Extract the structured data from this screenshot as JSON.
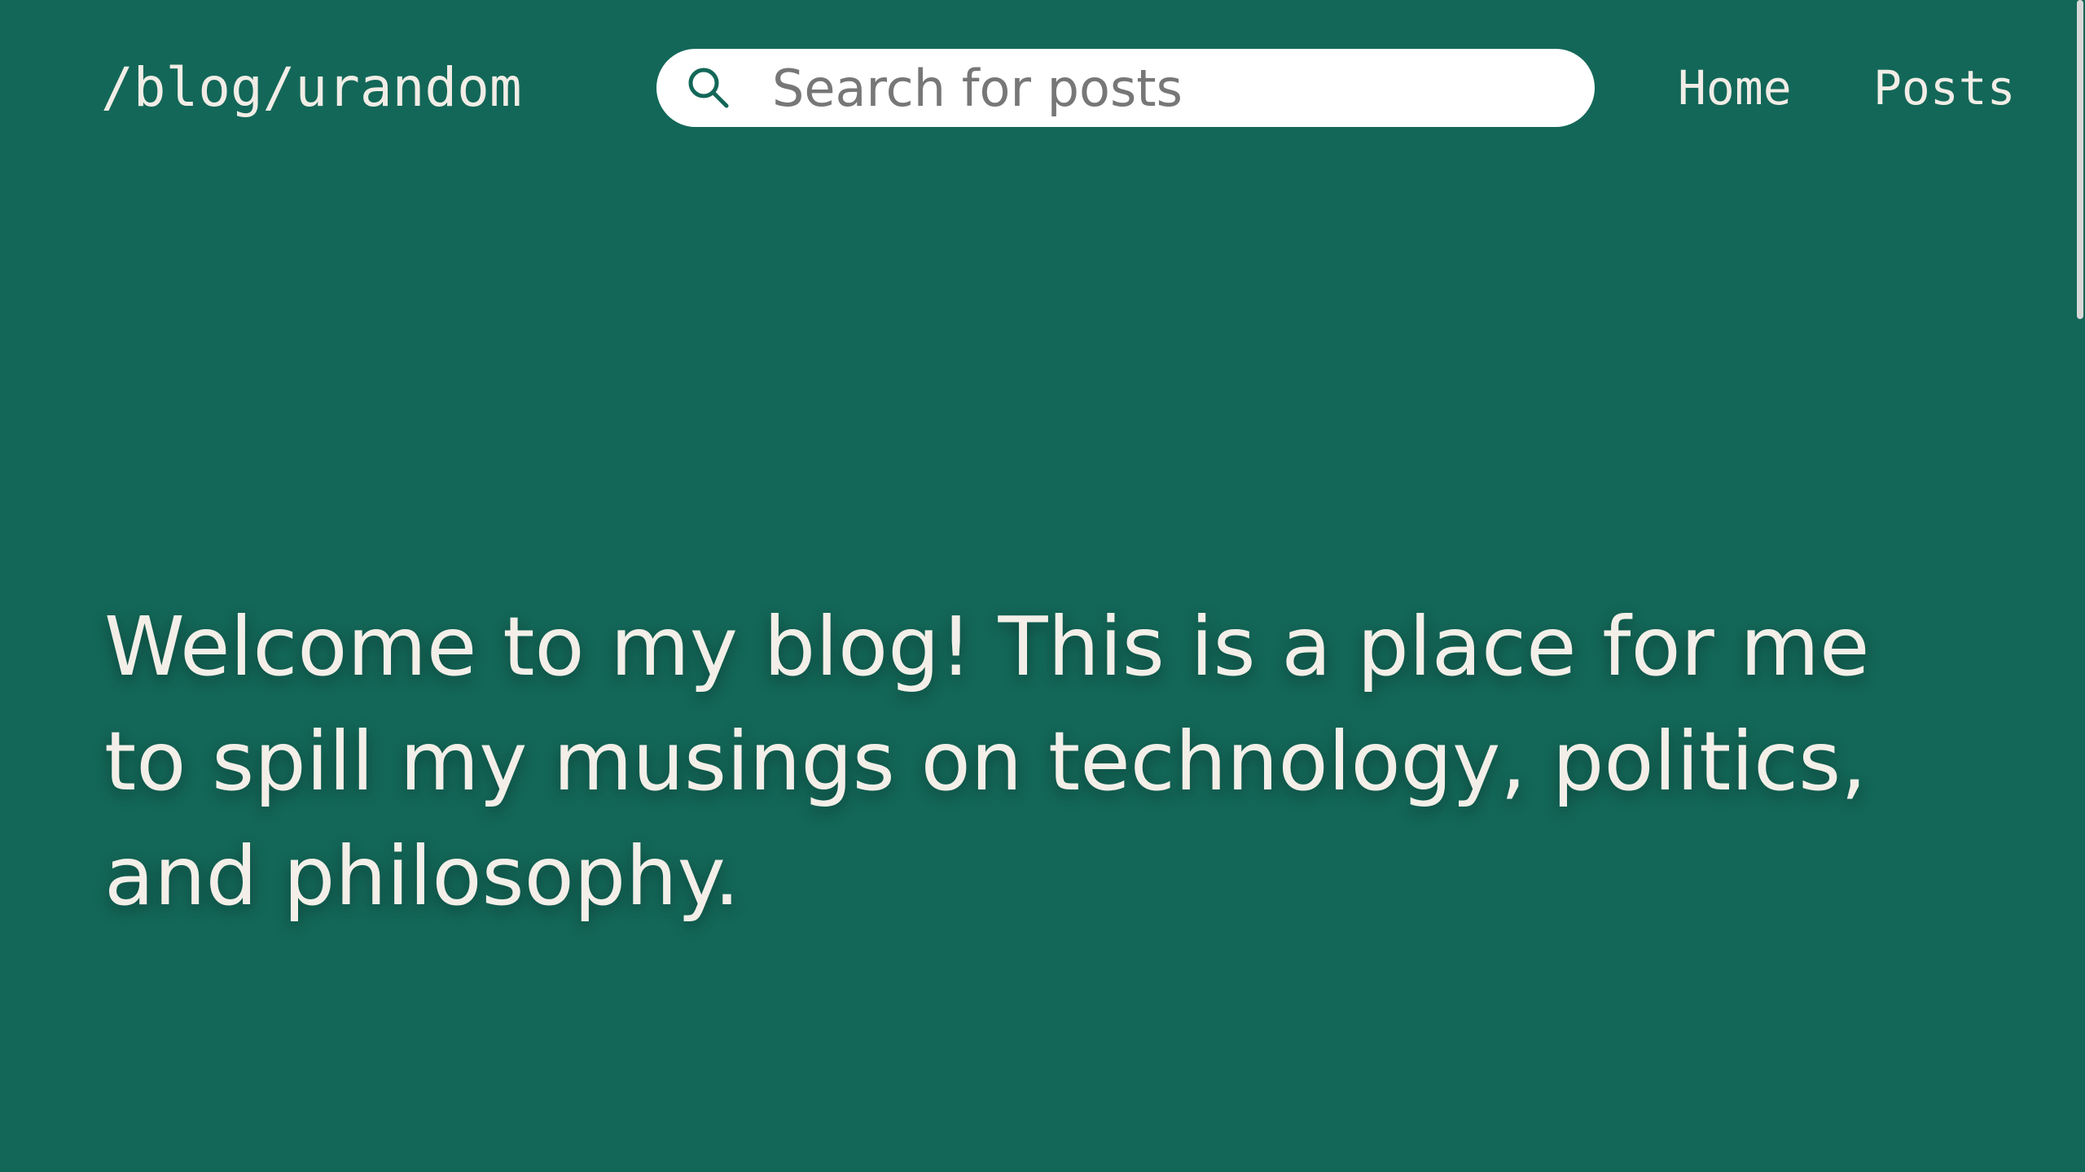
{
  "header": {
    "site_title": "/blog/urandom",
    "search": {
      "placeholder": "Search for posts",
      "value": "",
      "icon": "search-icon"
    },
    "nav": {
      "home": "Home",
      "posts": "Posts"
    }
  },
  "main": {
    "intro": "Welcome to my blog! This is a place for me to spill my musings on technology, politics, and philosophy."
  },
  "colors": {
    "background": "#136758",
    "text": "#f1ede6",
    "search_background": "#ffffff",
    "search_icon": "#136758"
  }
}
